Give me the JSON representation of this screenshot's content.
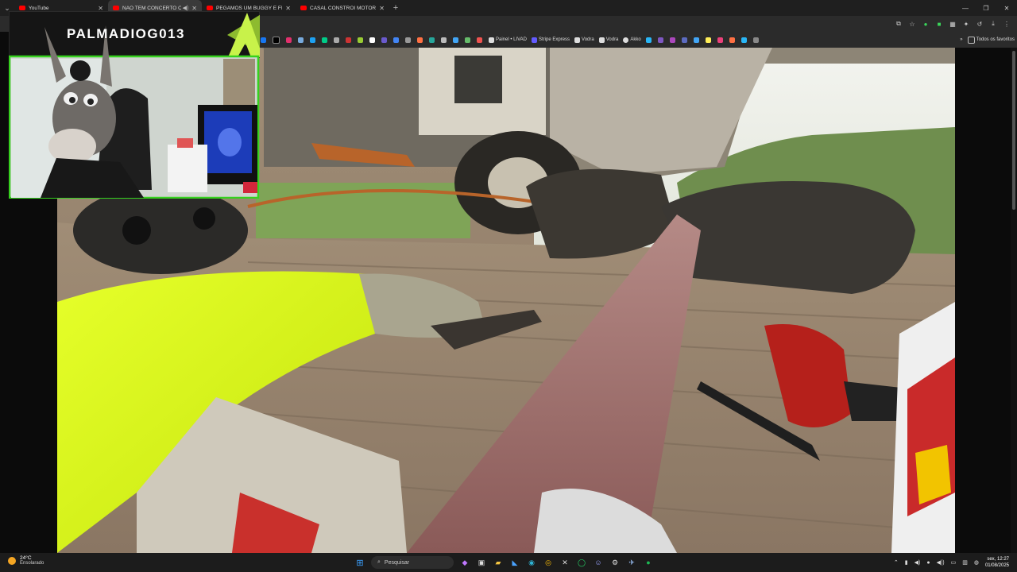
{
  "browser": {
    "tabs": [
      {
        "title": "YouTube",
        "active": false
      },
      {
        "title": "NÃO TEM CONCERTO O CA",
        "active": true
      },
      {
        "title": "PEGAMOS UM BUGGY E FIZEM",
        "active": false
      },
      {
        "title": "CASAL CONSTRÓI MOTORHOM",
        "active": false
      }
    ],
    "bookmarks": [
      {
        "label": "Painel • LIVAD",
        "color": "#dddddd"
      },
      {
        "label": "Stripe Express",
        "color": "#635bff"
      },
      {
        "label": "Vodra",
        "color": "#dddddd"
      },
      {
        "label": "Vodra",
        "color": "#dddddd"
      },
      {
        "label": "Akko",
        "color": "#dddddd"
      }
    ],
    "all_bookmarks_label": "Todos os favoritos"
  },
  "overlay": {
    "streamer_name": "PALMADIOG013"
  },
  "taskbar": {
    "weather_temp": "24°C",
    "weather_desc": "Ensolarado",
    "search_placeholder": "Pesquisar",
    "clock_day": "sex, 12:27",
    "clock_date": "01/08/2025"
  }
}
